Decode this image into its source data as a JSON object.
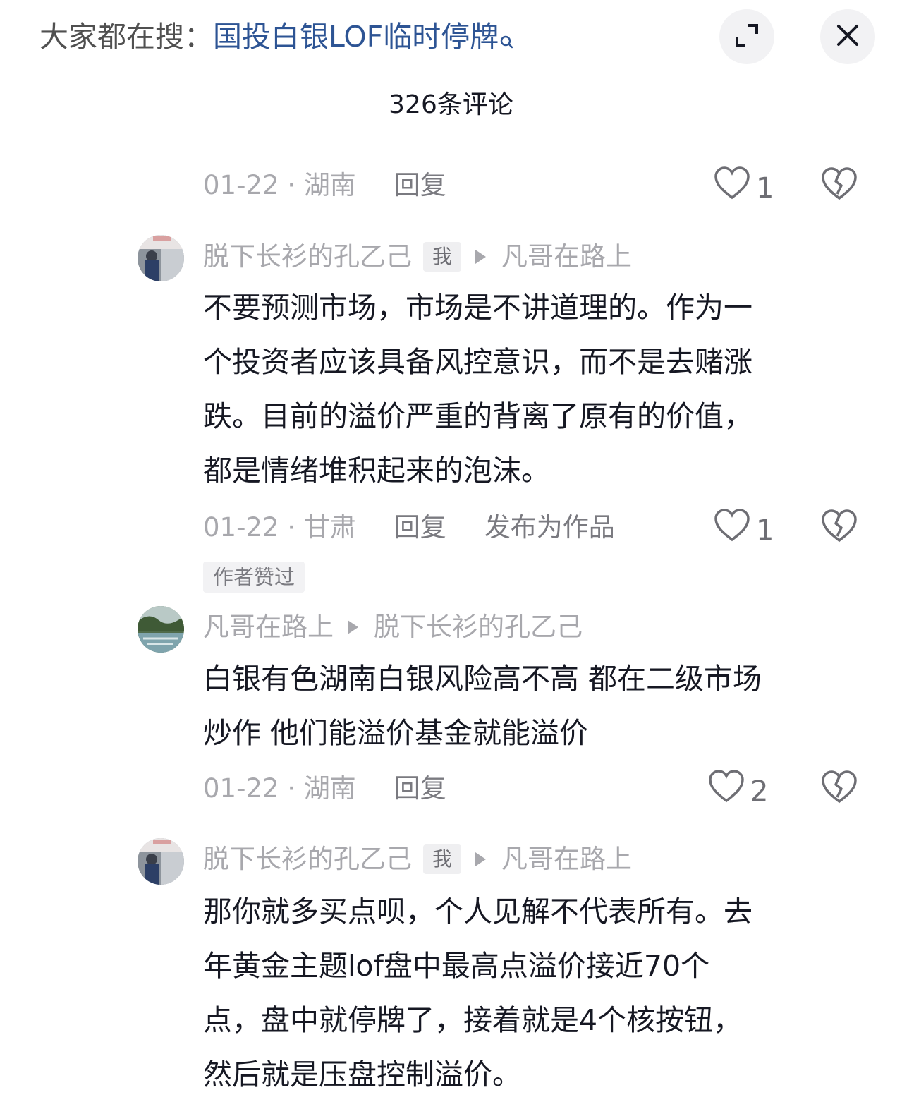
{
  "header": {
    "search_prefix": "大家都在搜：",
    "search_term": "国投白银LOF临时停牌",
    "comment_count": "326条评论"
  },
  "comments": [
    {
      "date": "01-22",
      "location": "湖南",
      "reply": "回复",
      "likes": "1"
    },
    {
      "author": "脱下长衫的孔乙己",
      "badge": "我",
      "reply_to": "凡哥在路上",
      "lines": [
        "不要预测市场，市场是不讲道理的。作为一",
        "个投资者应该具备风控意识，而不是去赌涨",
        "跌。目前的溢价严重的背离了原有的价值，",
        "都是情绪堆积起来的泡沫。"
      ],
      "date": "01-22",
      "location": "甘肃",
      "reply": "回复",
      "publish": "发布为作品",
      "likes": "1",
      "author_liked": "作者赞过"
    },
    {
      "author": "凡哥在路上",
      "reply_to": "脱下长衫的孔乙己",
      "lines": [
        "白银有色湖南白银风险高不高 都在二级市场",
        "炒作 他们能溢价基金就能溢价"
      ],
      "date": "01-22",
      "location": "湖南",
      "reply": "回复",
      "likes": "2"
    },
    {
      "author": "脱下长衫的孔乙己",
      "badge": "我",
      "reply_to": "凡哥在路上",
      "lines": [
        "那你就多买点呗，个人见解不代表所有。去",
        "年黄金主题lof盘中最高点溢价接近70个",
        "点，盘中就停牌了，接着就是4个核按钮，",
        "然后就是压盘控制溢价。"
      ]
    }
  ]
}
